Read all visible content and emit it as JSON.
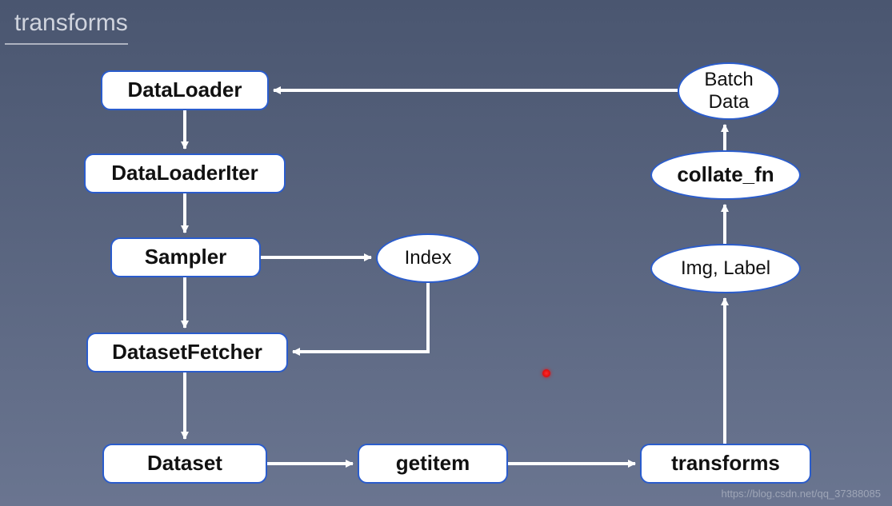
{
  "title": "transforms",
  "nodes": {
    "dataloader": "DataLoader",
    "dataloaderiter": "DataLoaderIter",
    "sampler": "Sampler",
    "datasetfetcher": "DatasetFetcher",
    "dataset": "Dataset",
    "getitem": "getitem",
    "transforms": "transforms",
    "index": "Index",
    "imglabel": "Img, Label",
    "collate_fn": "collate_fn",
    "batchdata": "Batch\nData"
  },
  "watermark": "https://blog.csdn.net/qq_37388085",
  "flow_edges": [
    [
      "DataLoader",
      "DataLoaderIter"
    ],
    [
      "DataLoaderIter",
      "Sampler"
    ],
    [
      "Sampler",
      "Index"
    ],
    [
      "Sampler",
      "DatasetFetcher"
    ],
    [
      "Index",
      "DatasetFetcher"
    ],
    [
      "DatasetFetcher",
      "Dataset"
    ],
    [
      "Dataset",
      "getitem"
    ],
    [
      "getitem",
      "transforms"
    ],
    [
      "transforms",
      "Img, Label"
    ],
    [
      "Img, Label",
      "collate_fn"
    ],
    [
      "collate_fn",
      "Batch Data"
    ],
    [
      "Batch Data",
      "DataLoader"
    ]
  ]
}
